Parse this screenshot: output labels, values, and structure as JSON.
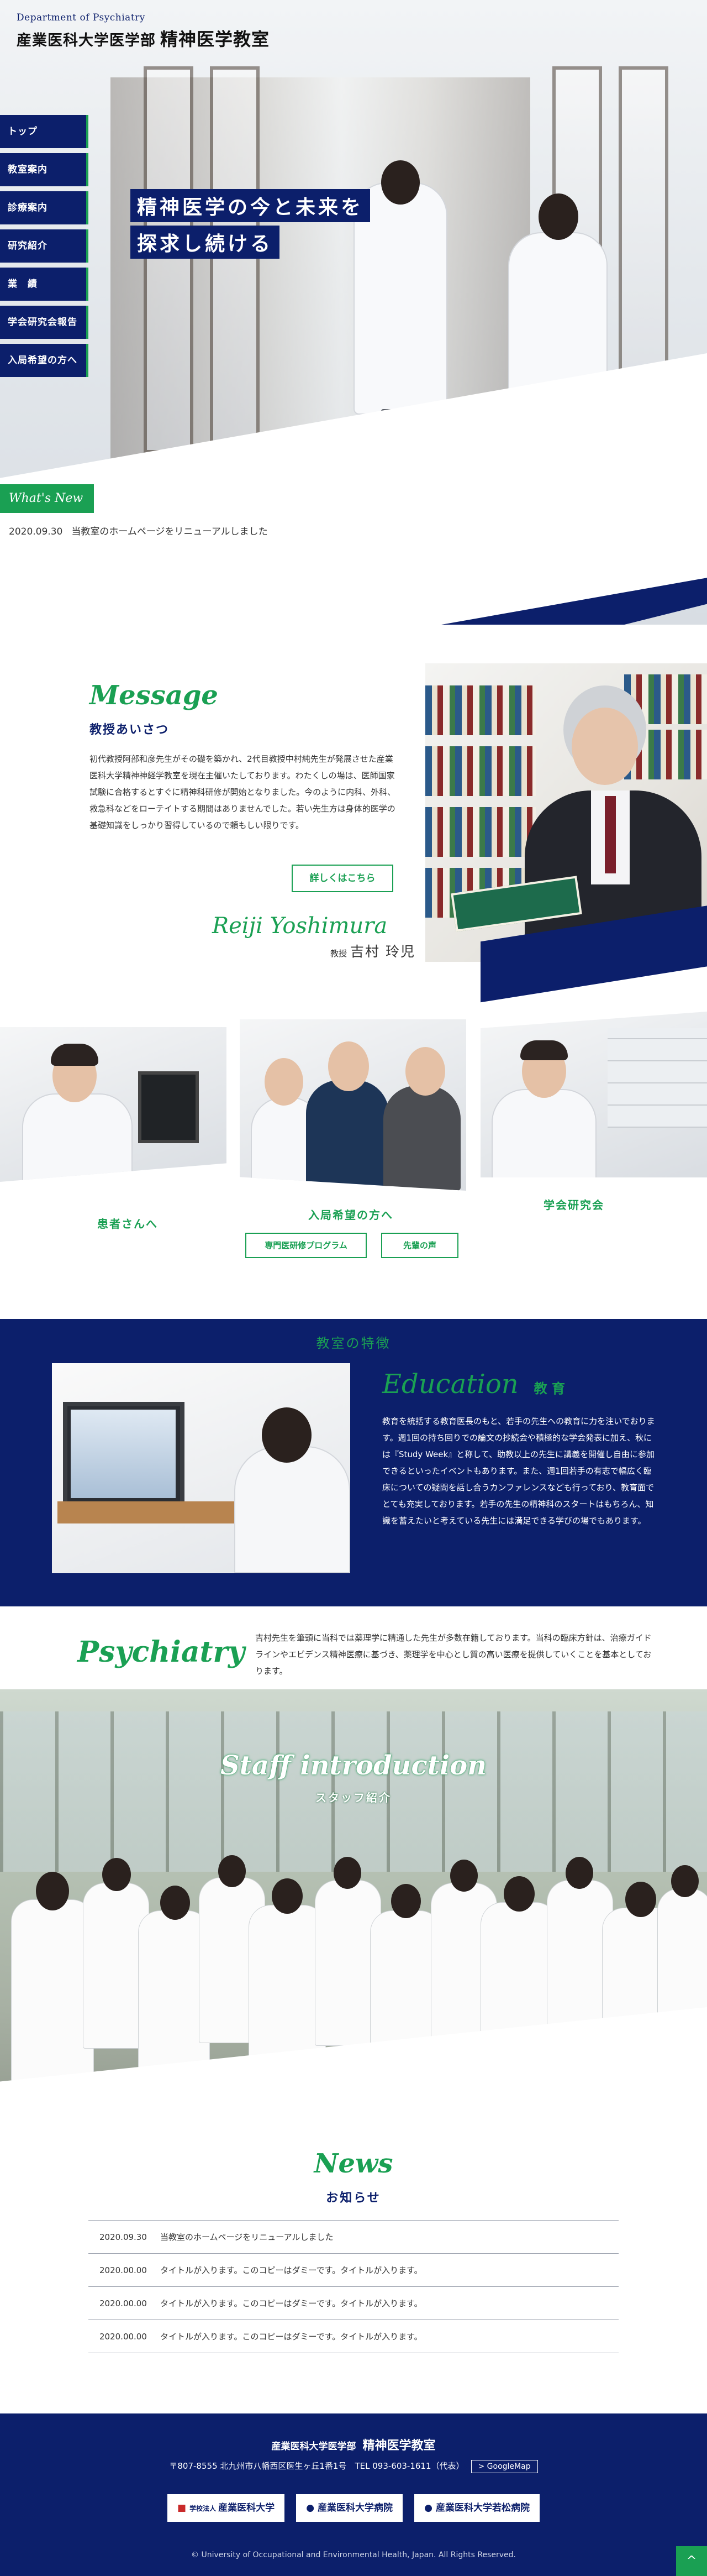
{
  "header": {
    "dept": "Department of Psychiatry",
    "university": "産業医科大学医学部",
    "lab": "精神医学教室"
  },
  "nav": [
    {
      "label": "トップ"
    },
    {
      "label": "教室案内"
    },
    {
      "label": "診療案内"
    },
    {
      "label": "研究紹介"
    },
    {
      "label": "業　績"
    },
    {
      "label": "学会研究会報告"
    },
    {
      "label": "入局希望の方へ"
    }
  ],
  "hero": {
    "copy_line1": "精神医学の今と未来を",
    "copy_line2": "探求し続ける",
    "whats_new": "What's New",
    "latest_date": "2020.09.30",
    "latest_text": "当教室のホームページをリニューアルしました"
  },
  "message": {
    "title": "Message",
    "subtitle": "教授あいさつ",
    "body": "初代教授阿部和彦先生がその礎を築かれ、2代目教授中村純先生が発展させた産業医科大学精神神経学教室を現在主催いたしております。わたくしの場は、医師国家試験に合格するとすぐに精神科研修が開始となりました。今のように内科、外科、救急科などをローテイトする期間はありませんでした。若い先生方は身体的医学の基礎知識をしっかり習得しているので頼もしい限りです。",
    "button": "詳しくはこちら",
    "sign_en": "Reiji Yoshimura",
    "sign_role": "教授",
    "sign_name": "吉村 玲児"
  },
  "links": {
    "patients": "患者さんへ",
    "applicants": "入局希望の方へ",
    "society": "学会研究会",
    "btn_program": "専門医研修プログラム",
    "btn_voice": "先輩の声"
  },
  "education": {
    "heading": "教室の特徴",
    "title": "Education",
    "title_ja": "教 育",
    "body": "教育を統括する教育医長のもと、若手の先生への教育に力を注いでおります。週1回の持ち回りでの論文の抄読会や積極的な学会発表に加え、秋には『Study Week』と称して、助教以上の先生に講義を開催し自由に参加できるといったイベントもあります。また、週1回若手の有志で幅広く臨床についての疑問を話し合うカンファレンスなども行っており、教育面でとても充実しております。若手の先生の精神科のスタートはもちろん、知識を蓄えたいと考えている先生には満足できる学びの場でもあります。"
  },
  "psychiatry": {
    "title": "Psychiatry",
    "body": "吉村先生を筆頭に当科では薬理学に精通した先生が多数在籍しております。当科の臨床方針は、治療ガイドラインやエビデンス精神医療に基づき、薬理学を中心とし質の高い医療を提供していくことを基本としております。"
  },
  "staff": {
    "title": "Staff introduction",
    "subtitle": "スタッフ紹介"
  },
  "news": {
    "title": "News",
    "subtitle": "お知らせ",
    "items": [
      {
        "date": "2020.09.30",
        "text": "当教室のホームページをリニューアルしました"
      },
      {
        "date": "2020.00.00",
        "text": "タイトルが入ります。このコピーはダミーです。タイトルが入ります。"
      },
      {
        "date": "2020.00.00",
        "text": "タイトルが入ります。このコピーはダミーです。タイトルが入ります。"
      },
      {
        "date": "2020.00.00",
        "text": "タイトルが入ります。このコピーはダミーです。タイトルが入ります。"
      }
    ]
  },
  "footer": {
    "university": "産業医科大学医学部",
    "lab": "精神医学教室",
    "address": "〒807-8555 北九州市八幡西区医生ヶ丘1番1号　TEL 093-603-1611（代表）",
    "gmap": "> GoogleMap",
    "logo1_mark": "学校法人",
    "logo1": "産業医科大学",
    "logo2": "産業医科大学病院",
    "logo3": "産業医科大学若松病院",
    "copyright": "© University of Occupational and Environmental Health, Japan. All Rights Reserved."
  },
  "pagetop": "^",
  "colors": {
    "navy": "#0c1f6b",
    "green": "#1aa053"
  }
}
